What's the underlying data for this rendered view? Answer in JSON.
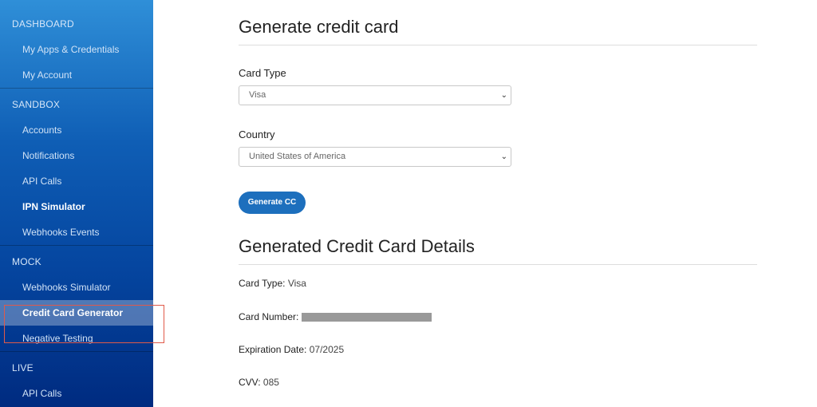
{
  "sidebar": {
    "sections": [
      {
        "title": "DASHBOARD",
        "items": [
          "My Apps & Credentials",
          "My Account"
        ]
      },
      {
        "title": "SANDBOX",
        "items": [
          "Accounts",
          "Notifications",
          "API Calls",
          "IPN Simulator",
          "Webhooks Events"
        ]
      },
      {
        "title": "MOCK",
        "items": [
          "Webhooks Simulator",
          "Credit Card Generator",
          "Negative Testing"
        ]
      },
      {
        "title": "LIVE",
        "items": [
          "API Calls"
        ]
      }
    ],
    "active_item": "Credit Card Generator"
  },
  "main": {
    "title": "Generate credit card",
    "card_type_label": "Card Type",
    "card_type_value": "Visa",
    "country_label": "Country",
    "country_value": "United States of America",
    "generate_button": "Generate CC",
    "details_title": "Generated Credit Card Details",
    "details": {
      "card_type_label": "Card Type:",
      "card_type_value": "Visa",
      "card_number_label": "Card Number:",
      "expiration_label": "Expiration Date:",
      "expiration_value": "07/2025",
      "cvv_label": "CVV:",
      "cvv_value": "085"
    }
  },
  "colors": {
    "accent": "#1d6fbd",
    "highlight_border": "#e05a4a"
  }
}
